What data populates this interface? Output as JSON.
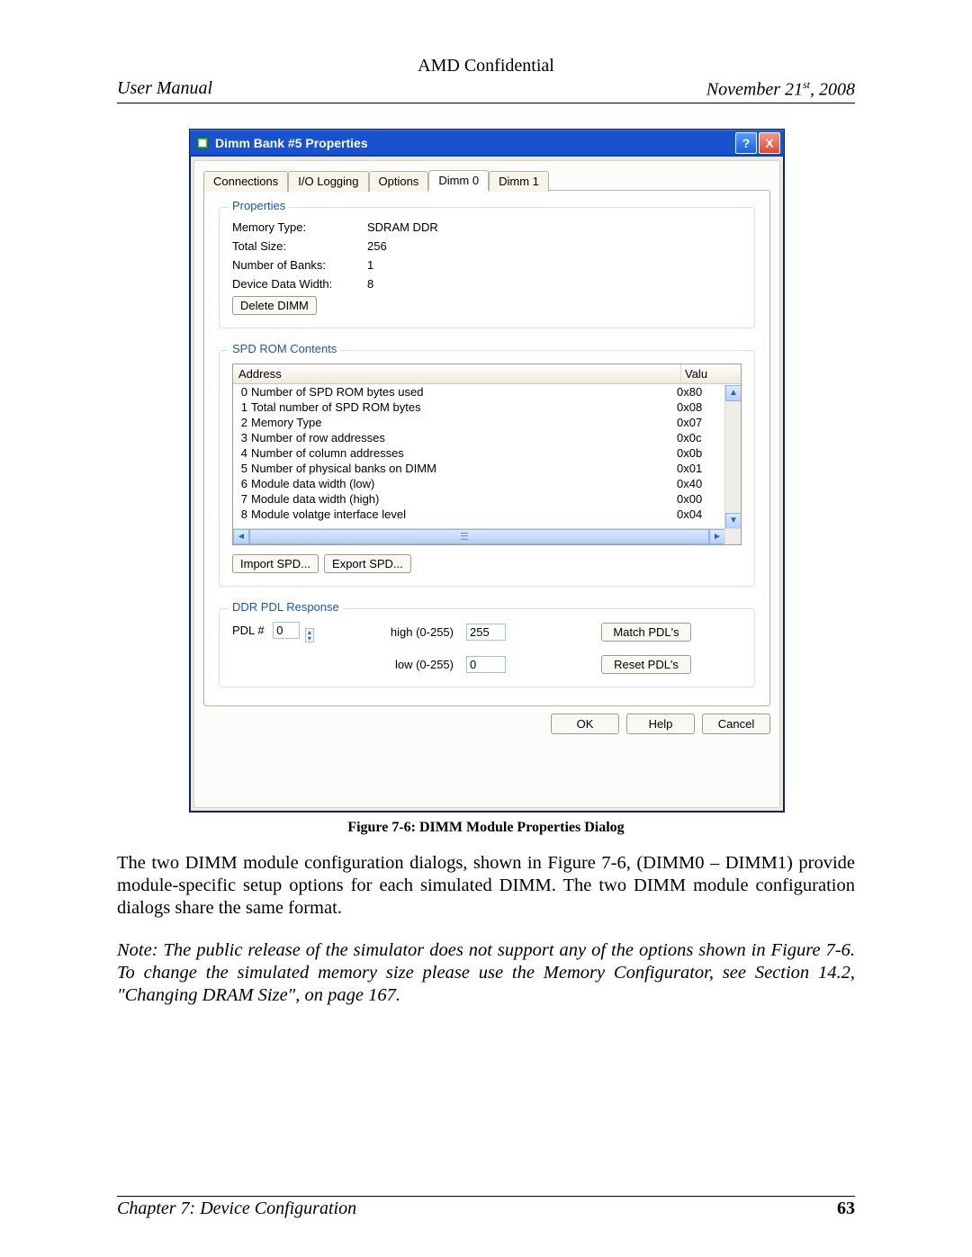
{
  "header": {
    "top_center": "AMD Confidential",
    "left": "User Manual",
    "right_prefix": "November 21",
    "right_super": "st",
    "right_suffix": ", 2008"
  },
  "dialog": {
    "title": "Dimm Bank #5 Properties",
    "help_btn": "?",
    "close_btn": "X",
    "tabs": {
      "connections": "Connections",
      "io_logging": "I/O Logging",
      "options": "Options",
      "dimm0": "Dimm 0",
      "dimm1": "Dimm 1"
    },
    "properties": {
      "legend": "Properties",
      "memory_type_label": "Memory Type:",
      "memory_type_value": "SDRAM DDR",
      "total_size_label": "Total Size:",
      "total_size_value": "256",
      "num_banks_label": "Number of Banks:",
      "num_banks_value": "1",
      "data_width_label": "Device Data Width:",
      "data_width_value": "8",
      "delete_btn": "Delete DIMM"
    },
    "spd": {
      "legend": "SPD ROM Contents",
      "col_address": "Address",
      "col_value_trunc": "Valu",
      "rows": [
        {
          "idx": "0",
          "addr": "Number of SPD ROM bytes used",
          "val": "0x80"
        },
        {
          "idx": "1",
          "addr": "Total number of SPD ROM bytes",
          "val": "0x08"
        },
        {
          "idx": "2",
          "addr": "Memory Type",
          "val": "0x07"
        },
        {
          "idx": "3",
          "addr": "Number of row addresses",
          "val": "0x0c"
        },
        {
          "idx": "4",
          "addr": "Number of column addresses",
          "val": "0x0b"
        },
        {
          "idx": "5",
          "addr": "Number of physical banks on DIMM",
          "val": "0x01"
        },
        {
          "idx": "6",
          "addr": "Module data width (low)",
          "val": "0x40"
        },
        {
          "idx": "7",
          "addr": "Module data width (high)",
          "val": "0x00"
        },
        {
          "idx": "8",
          "addr": "Module volatge interface level",
          "val": "0x04"
        }
      ],
      "import_btn": "Import SPD...",
      "export_btn": "Export SPD..."
    },
    "pdl": {
      "legend": "DDR PDL Response",
      "pdl_num_label": "PDL #",
      "pdl_num_value": "0",
      "high_label": "high (0-255)",
      "high_value": "255",
      "low_label": "low (0-255)",
      "low_value": "0",
      "match_btn": "Match PDL's",
      "reset_btn": "Reset PDL's"
    },
    "buttons": {
      "ok": "OK",
      "help": "Help",
      "cancel": "Cancel"
    }
  },
  "caption": "Figure 7-6: DIMM Module Properties Dialog",
  "para1": "The two DIMM module configuration dialogs, shown in Figure 7-6, (DIMM0 – DIMM1) provide module-specific setup options for each simulated DIMM. The two DIMM module configuration dialogs share the same format.",
  "note": "Note: The public release of the simulator does not support any of the options shown in Figure 7-6. To change the simulated memory size please use the Memory Configurator, see Section 14.2, \"Changing DRAM Size\", on page 167.",
  "footer": {
    "left": "Chapter 7: Device Configuration",
    "page": "63"
  }
}
